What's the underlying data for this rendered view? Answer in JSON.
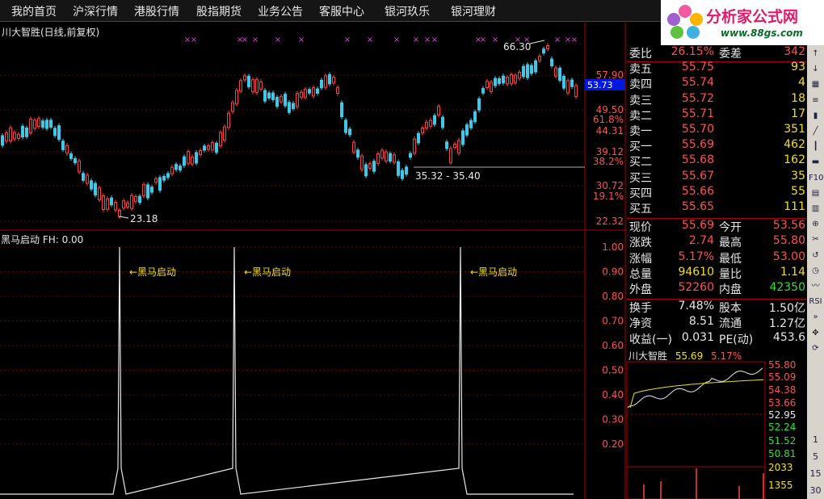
{
  "menu": [
    "我的首页",
    "沪深行情",
    "港股行情",
    "股指期货",
    "业务公告",
    "客服中心",
    "银河玖乐",
    "银河理财"
  ],
  "logo": {
    "text": "分析家公式网",
    "url": "www.88gs.com"
  },
  "chart": {
    "title": "川大智胜(日线,前复权)",
    "price_axis": [
      "57.90",
      "49.50",
      "44.31",
      "39.12",
      "30.72",
      "22.32"
    ],
    "pct_axis": [
      "61.8%",
      "38.2%",
      "19.1%"
    ],
    "current_price": "53.73",
    "high_label": "66.30",
    "low_label": "23.18",
    "range_label": "35.32 - 35.40"
  },
  "indicator": {
    "title": "黑马启动 FH: 0.00",
    "signal_label": "黑马启动",
    "axis": [
      "1.00",
      "0.90",
      "0.80",
      "0.70",
      "0.60",
      "0.50",
      "0.40",
      "0.30",
      "0.20"
    ]
  },
  "quote": {
    "rows": [
      {
        "l": "委比",
        "v": "26.15%",
        "vc": "red",
        "l2": "委差",
        "v2": "342",
        "v2c": "red"
      },
      {
        "l": "卖五",
        "v": "55.75",
        "vc": "red",
        "v2": "93",
        "v2c": "yellow"
      },
      {
        "l": "卖四",
        "v": "55.74",
        "vc": "red",
        "v2": "4",
        "v2c": "yellow"
      },
      {
        "l": "卖三",
        "v": "55.72",
        "vc": "red",
        "v2": "18",
        "v2c": "yellow"
      },
      {
        "l": "卖二",
        "v": "55.71",
        "vc": "red",
        "v2": "17",
        "v2c": "yellow"
      },
      {
        "l": "卖一",
        "v": "55.70",
        "vc": "red",
        "v2": "351",
        "v2c": "yellow"
      },
      {
        "l": "买一",
        "v": "55.69",
        "vc": "red",
        "v2": "462",
        "v2c": "yellow"
      },
      {
        "l": "买二",
        "v": "55.68",
        "vc": "red",
        "v2": "162",
        "v2c": "yellow"
      },
      {
        "l": "买三",
        "v": "55.67",
        "vc": "red",
        "v2": "35",
        "v2c": "yellow"
      },
      {
        "l": "买四",
        "v": "55.66",
        "vc": "red",
        "v2": "55",
        "v2c": "yellow"
      },
      {
        "l": "买五",
        "v": "55.65",
        "vc": "red",
        "v2": "111",
        "v2c": "yellow"
      },
      {
        "l": "现价",
        "v": "55.69",
        "vc": "red",
        "l2": "今开",
        "v2": "53.56",
        "v2c": "red"
      },
      {
        "l": "涨跌",
        "v": "2.74",
        "vc": "red",
        "l2": "最高",
        "v2": "55.80",
        "v2c": "red"
      },
      {
        "l": "涨幅",
        "v": "5.17%",
        "vc": "red",
        "l2": "最低",
        "v2": "53.00",
        "v2c": "red"
      },
      {
        "l": "总量",
        "v": "94610",
        "vc": "yellow",
        "l2": "量比",
        "v2": "1.14",
        "v2c": "yellow"
      },
      {
        "l": "外盘",
        "v": "52260",
        "vc": "red",
        "l2": "内盘",
        "v2": "42350",
        "v2c": "green"
      },
      {
        "l": "换手",
        "v": "7.48%",
        "vc": "white",
        "l2": "股本",
        "v2": "1.50亿",
        "v2c": "white"
      },
      {
        "l": "净资",
        "v": "8.51",
        "vc": "white",
        "l2": "流通",
        "v2": "1.27亿",
        "v2c": "white"
      },
      {
        "l": "收益(一)",
        "v": "0.031",
        "vc": "white",
        "l2": "PE(动)",
        "v2": "453.6",
        "v2c": "white"
      }
    ]
  },
  "mini": {
    "name": "川大智胜",
    "price": "55.69",
    "pct": "5.17%",
    "axis_red": [
      "55.80",
      "55.09",
      "54.38",
      "53.66"
    ],
    "axis_mid": "52.95",
    "axis_green": [
      "52.24",
      "51.52",
      "50.81"
    ],
    "vol": [
      "2033",
      "1355"
    ]
  },
  "toolbar": {
    "icons": [
      "up-arrow-icon",
      "down-arrow-icon",
      "grid-icon",
      "list-icon",
      "bar-icon",
      "line-icon",
      "candle-icon",
      "flat-icon",
      "f10-icon",
      "doc-icon",
      "page-icon",
      "zoom-icon",
      "scissor-icon",
      "back-icon",
      "clock-icon",
      "wave-icon",
      "rsi-icon",
      "fast-icon",
      "arrows-icon",
      "refresh-icon"
    ],
    "labels": {
      "f10": "F10",
      "rsi": "RSI"
    },
    "periods": [
      "1",
      "5",
      "15",
      "30"
    ]
  }
}
